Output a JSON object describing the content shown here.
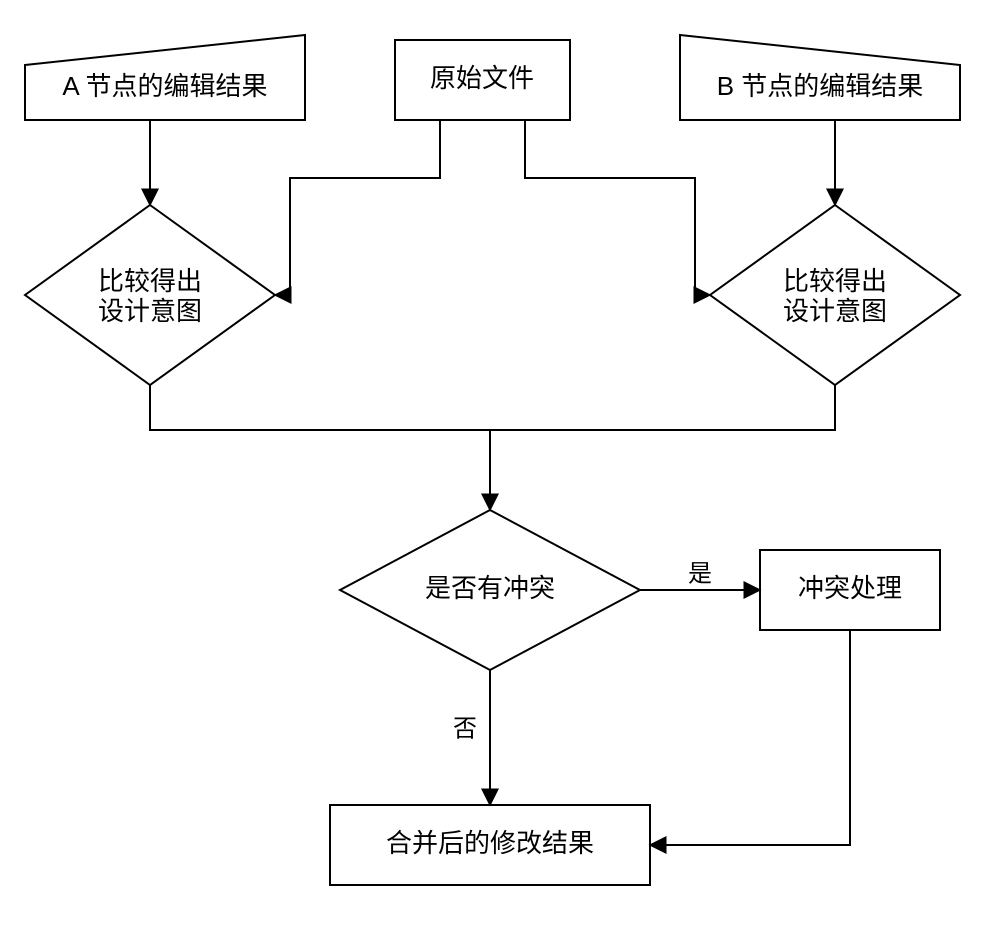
{
  "nodes": {
    "inputA": {
      "label": "A 节点的编辑结果"
    },
    "inputB": {
      "label": "B 节点的编辑结果"
    },
    "original": {
      "label": "原始文件"
    },
    "compareA": {
      "line1": "比较得出",
      "line2": "设计意图"
    },
    "compareB": {
      "line1": "比较得出",
      "line2": "设计意图"
    },
    "conflict": {
      "label": "是否有冲突"
    },
    "handle": {
      "label": "冲突处理"
    },
    "merged": {
      "label": "合并后的修改结果"
    }
  },
  "edges": {
    "yes": "是",
    "no": "否"
  },
  "chart_data": {
    "type": "flowchart",
    "nodes": [
      {
        "id": "inputA",
        "shape": "trapezoid-left",
        "label": "A 节点的编辑结果"
      },
      {
        "id": "original",
        "shape": "rectangle",
        "label": "原始文件"
      },
      {
        "id": "inputB",
        "shape": "trapezoid-right",
        "label": "B 节点的编辑结果"
      },
      {
        "id": "compareA",
        "shape": "diamond",
        "label": "比较得出设计意图"
      },
      {
        "id": "compareB",
        "shape": "diamond",
        "label": "比较得出设计意图"
      },
      {
        "id": "conflict",
        "shape": "diamond",
        "label": "是否有冲突"
      },
      {
        "id": "handle",
        "shape": "rectangle",
        "label": "冲突处理"
      },
      {
        "id": "merged",
        "shape": "rectangle",
        "label": "合并后的修改结果"
      }
    ],
    "edges": [
      {
        "from": "inputA",
        "to": "compareA"
      },
      {
        "from": "original",
        "to": "compareA"
      },
      {
        "from": "inputB",
        "to": "compareB"
      },
      {
        "from": "original",
        "to": "compareB"
      },
      {
        "from": "compareA",
        "to": "conflict"
      },
      {
        "from": "compareB",
        "to": "conflict"
      },
      {
        "from": "conflict",
        "to": "handle",
        "label": "是"
      },
      {
        "from": "conflict",
        "to": "merged",
        "label": "否"
      },
      {
        "from": "handle",
        "to": "merged"
      }
    ]
  }
}
